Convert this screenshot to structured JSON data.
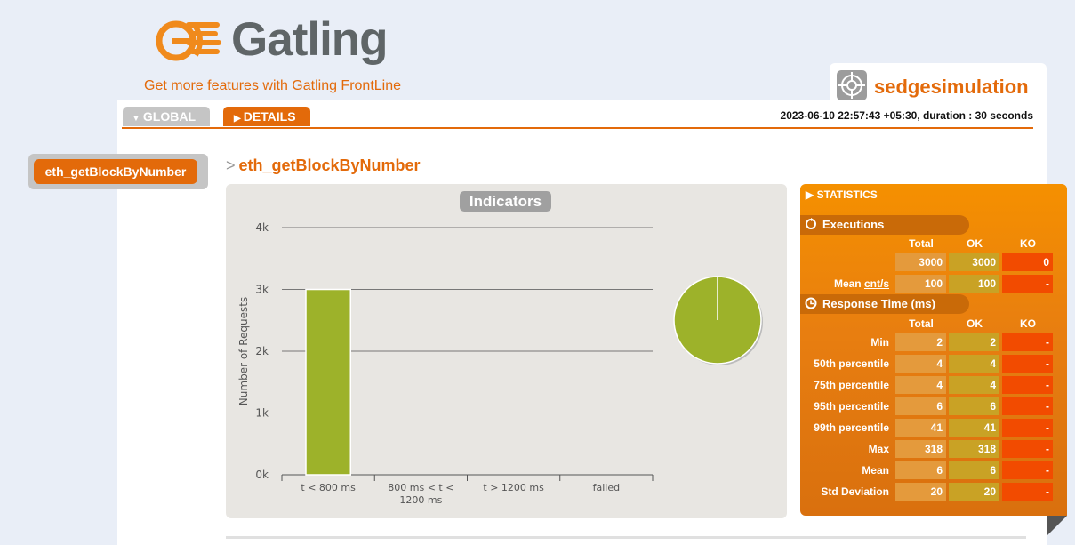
{
  "header": {
    "logo_text": "Gatling",
    "frontline_link": "Get more features with Gatling FrontLine",
    "simulation_name": "sedgesimulation",
    "run_info": "2023-06-10 22:57:43 +05:30, duration : 30 seconds"
  },
  "tabs": [
    {
      "label": "GLOBAL"
    },
    {
      "label": "DETAILS"
    }
  ],
  "sidebar": {
    "items": [
      {
        "label": "eth_getBlockByNumber"
      }
    ]
  },
  "request_title": "eth_getBlockByNumber",
  "indicators_label": "Indicators",
  "chart_data": {
    "type": "bar",
    "ylabel": "Number of Requests",
    "y_ticks": [
      "0k",
      "1k",
      "2k",
      "3k",
      "4k"
    ],
    "ylim": [
      0,
      4000
    ],
    "categories": [
      "t < 800 ms",
      "800 ms < t < 1200 ms",
      "t > 1200 ms",
      "failed"
    ],
    "category_lines": [
      [
        "t < 800 ms"
      ],
      [
        "800 ms < t <",
        "1200 ms"
      ],
      [
        "t > 1200 ms"
      ],
      [
        "failed"
      ]
    ],
    "values": [
      3000,
      0,
      0,
      0
    ],
    "bar_color": "#9db22a",
    "pie": {
      "values": [
        3000,
        0,
        0,
        0
      ],
      "colors": [
        "#9db22a",
        "#f5b60d",
        "#e88b1a",
        "#f24b00"
      ]
    }
  },
  "statistics": {
    "title": "STATISTICS",
    "executions": {
      "heading": "Executions",
      "columns": [
        "Total",
        "OK",
        "KO"
      ],
      "rows": [
        {
          "label": "",
          "total": "3000",
          "ok": "3000",
          "ko": "0"
        },
        {
          "label": "Mean",
          "label_unit": "cnt/s",
          "total": "100",
          "ok": "100",
          "ko": "-"
        }
      ]
    },
    "response_time": {
      "heading": "Response Time (ms)",
      "columns": [
        "Total",
        "OK",
        "KO"
      ],
      "rows": [
        {
          "label": "Min",
          "total": "2",
          "ok": "2",
          "ko": "-"
        },
        {
          "label": "50th percentile",
          "total": "4",
          "ok": "4",
          "ko": "-"
        },
        {
          "label": "75th percentile",
          "total": "4",
          "ok": "4",
          "ko": "-"
        },
        {
          "label": "95th percentile",
          "total": "6",
          "ok": "6",
          "ko": "-"
        },
        {
          "label": "99th percentile",
          "total": "41",
          "ok": "41",
          "ko": "-"
        },
        {
          "label": "Max",
          "total": "318",
          "ok": "318",
          "ko": "-"
        },
        {
          "label": "Mean",
          "total": "6",
          "ok": "6",
          "ko": "-"
        },
        {
          "label": "Std Deviation",
          "total": "20",
          "ok": "20",
          "ko": "-"
        }
      ]
    }
  }
}
